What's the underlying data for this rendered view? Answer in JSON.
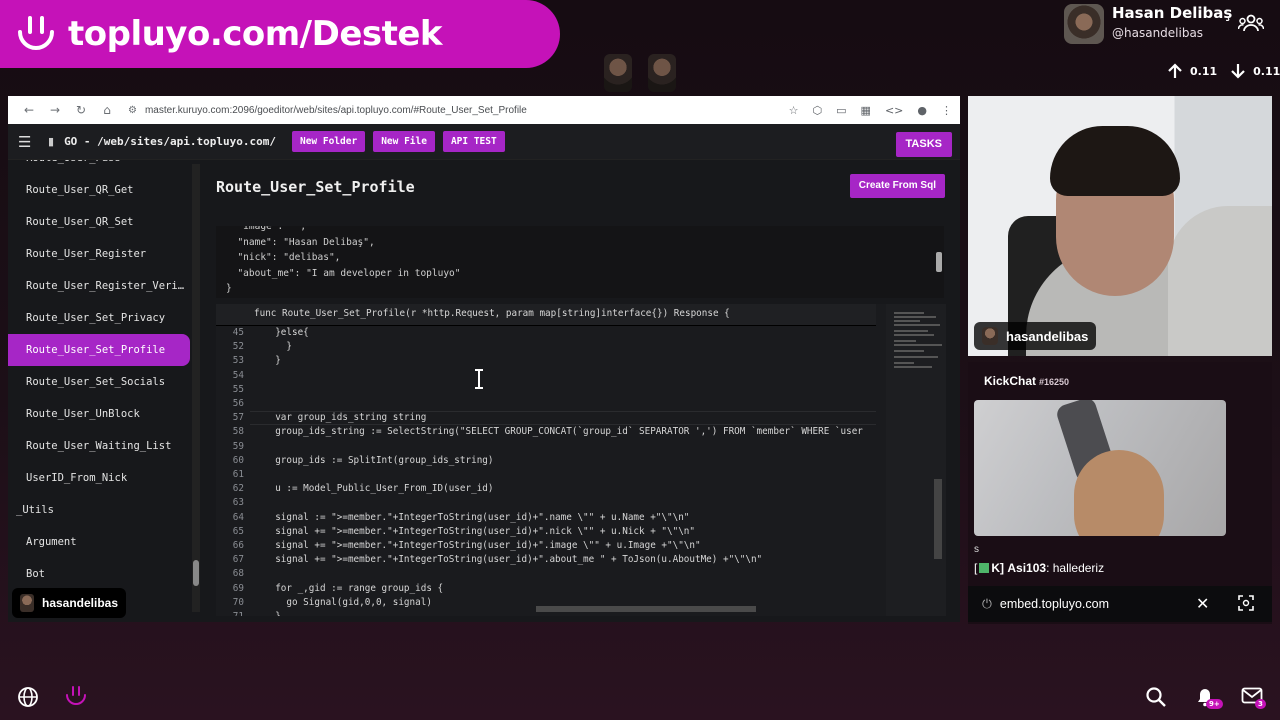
{
  "banner": {
    "title": "topluyo.com/Destek"
  },
  "profile": {
    "name": "Hasan Delibaş",
    "handle": "@hasandelibas"
  },
  "speeds": {
    "up": "0.11",
    "down": "0.11"
  },
  "browser": {
    "url": "master.kuruyo.com:2096/goeditor/web/sites/api.topluyo.com/#Route_User_Set_Profile"
  },
  "app": {
    "path": "GO - /web/sites/api.topluyo.com/",
    "buttons": {
      "new_folder": "New Folder",
      "new_file": "New File",
      "api_test": "API TEST",
      "tasks": "TASKS"
    },
    "page_title": "Route_User_Set_Profile",
    "create_from_sql": "Create From Sql"
  },
  "sidebar": {
    "items": [
      "Route_User_Pass",
      "Route_User_QR_Get",
      "Route_User_QR_Set",
      "Route_User_Register",
      "Route_User_Register_Veri…",
      "Route_User_Set_Privacy",
      "Route_User_Set_Profile",
      "Route_User_Set_Socials",
      "Route_User_UnBlock",
      "Route_User_Waiting_List",
      "UserID_From_Nick",
      "_Utils",
      "Argument",
      "Bot"
    ],
    "active": "Route_User_Set_Profile",
    "user": "hasandelibas"
  },
  "json_preview": {
    "lines": [
      "  \"image\": \"\",",
      "  \"name\": \"Hasan Delibaş\",",
      "  \"nick\": \"delibas\",",
      "  \"about_me\": \"I am developer in topluyo\"",
      "}"
    ]
  },
  "code": {
    "sticky": "func Route_User_Set_Profile(r *http.Request, param map[string]interface{}) Response {",
    "lines": [
      {
        "n": "45",
        "t": "  }else{"
      },
      {
        "n": "52",
        "t": "    }"
      },
      {
        "n": "53",
        "t": "  }"
      },
      {
        "n": "54",
        "t": ""
      },
      {
        "n": "55",
        "t": ""
      },
      {
        "n": "56",
        "t": ""
      },
      {
        "n": "57",
        "t": "  var group_ids_string string"
      },
      {
        "n": "58",
        "t": "  group_ids_string := SelectString(\"SELECT GROUP_CONCAT(`group_id` SEPARATOR ',') FROM `member` WHERE `user"
      },
      {
        "n": "59",
        "t": ""
      },
      {
        "n": "60",
        "t": "  group_ids := SplitInt(group_ids_string)"
      },
      {
        "n": "61",
        "t": ""
      },
      {
        "n": "62",
        "t": "  u := Model_Public_User_From_ID(user_id)"
      },
      {
        "n": "63",
        "t": ""
      },
      {
        "n": "64",
        "t": "  signal := \">=member.\"+IntegerToString(user_id)+\".name \\\"\" + u.Name +\"\\\"\\n\""
      },
      {
        "n": "65",
        "t": "  signal += \">=member.\"+IntegerToString(user_id)+\".nick \\\"\" + u.Nick + \"\\\"\\n\""
      },
      {
        "n": "66",
        "t": "  signal += \">=member.\"+IntegerToString(user_id)+\".image \\\"\" + u.Image +\"\\\"\\n\""
      },
      {
        "n": "67",
        "t": "  signal += \">=member.\"+IntegerToString(user_id)+\".about_me \" + ToJson(u.AboutMe) +\"\\\"\\n\""
      },
      {
        "n": "68",
        "t": ""
      },
      {
        "n": "69",
        "t": "  for _,gid := range group_ids {"
      },
      {
        "n": "70",
        "t": "    go Signal(gid,0,0, signal)"
      },
      {
        "n": "71",
        "t": "  }"
      }
    ]
  },
  "cam": {
    "label": "hasandelibas"
  },
  "chat": {
    "title": "KickChat",
    "id": "#16250",
    "msg1": "s",
    "msg2_prefix": "[",
    "msg2_suffix": "K]",
    "msg2_user": "Asi103",
    "msg2_text": ": hallederiz",
    "embed": "embed.topluyo.com"
  },
  "bottom": {
    "bell_badge": "9+",
    "mail_badge": "3"
  },
  "colors": {
    "accent": "#a626c6",
    "banner": "#c512b8"
  }
}
